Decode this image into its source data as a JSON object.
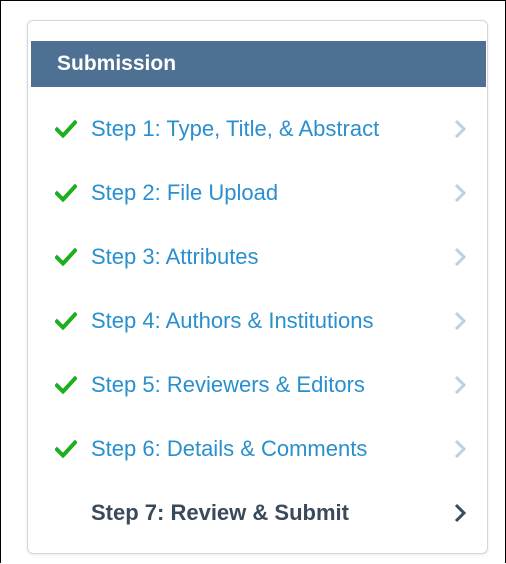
{
  "panel": {
    "title": "Submission"
  },
  "steps": [
    {
      "label": "Step 1: Type, Title, & Abstract",
      "completed": true,
      "current": false
    },
    {
      "label": "Step 2: File Upload",
      "completed": true,
      "current": false
    },
    {
      "label": "Step 3: Attributes",
      "completed": true,
      "current": false
    },
    {
      "label": "Step 4: Authors & Institutions",
      "completed": true,
      "current": false
    },
    {
      "label": "Step 5: Reviewers & Editors",
      "completed": true,
      "current": false
    },
    {
      "label": "Step 6: Details & Comments",
      "completed": true,
      "current": false
    },
    {
      "label": "Step 7: Review & Submit",
      "completed": false,
      "current": true
    }
  ],
  "icons": {
    "check": "checkmark-icon",
    "chevron": "chevron-right-icon"
  },
  "colors": {
    "header_bg": "#4e7193",
    "link": "#2a8fce",
    "current_text": "#3b4a5a",
    "check": "#1fae1f",
    "chevron_inactive": "#b7d3e6",
    "chevron_active": "#3b4a5a"
  }
}
